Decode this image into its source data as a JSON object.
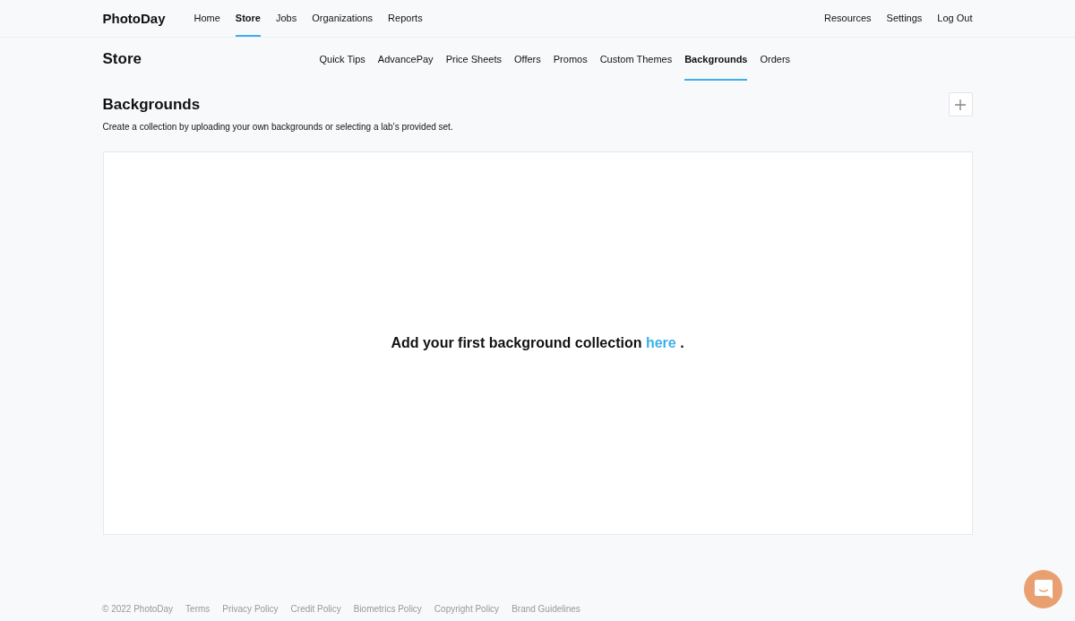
{
  "logo": "PhotoDay",
  "nav": [
    {
      "label": "Home",
      "selected": false
    },
    {
      "label": "Store",
      "selected": true
    },
    {
      "label": "Jobs",
      "selected": false
    },
    {
      "label": "Organizations",
      "selected": false
    },
    {
      "label": "Reports",
      "selected": false
    }
  ],
  "nav_right": [
    "Resources",
    "Settings",
    "Log Out"
  ],
  "page_title": "Store",
  "subnav": [
    {
      "label": "Quick Tips",
      "selected": false
    },
    {
      "label": "AdvancePay",
      "selected": false
    },
    {
      "label": "Price Sheets",
      "selected": false
    },
    {
      "label": "Offers",
      "selected": false
    },
    {
      "label": "Promos",
      "selected": false
    },
    {
      "label": "Custom Themes",
      "selected": false
    },
    {
      "label": "Backgrounds",
      "selected": true
    },
    {
      "label": "Orders",
      "selected": false
    }
  ],
  "section": {
    "title": "Backgrounds",
    "description": "Create a collection by uploading your own backgrounds or selecting a lab’s provided set."
  },
  "empty_state": {
    "text_before": "Add your first background collection",
    "link": "here",
    "text_after": "."
  },
  "footer": {
    "copyright": "© 2022 PhotoDay",
    "links": [
      "Terms",
      "Privacy Policy",
      "Credit Policy",
      "Biometrics Policy",
      "Copyright Policy",
      "Brand Guidelines"
    ]
  }
}
